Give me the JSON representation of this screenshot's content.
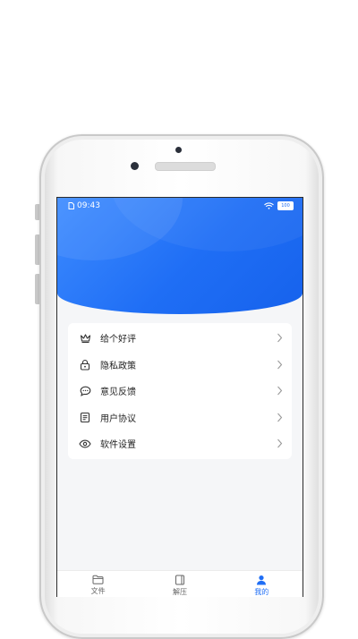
{
  "status_bar": {
    "time": "09:43",
    "battery": "100"
  },
  "menu": {
    "items": [
      {
        "label": "给个好评",
        "icon": "crown-icon"
      },
      {
        "label": "隐私政策",
        "icon": "lock-icon"
      },
      {
        "label": "意见反馈",
        "icon": "chat-icon"
      },
      {
        "label": "用户协议",
        "icon": "document-icon"
      },
      {
        "label": "软件设置",
        "icon": "eye-icon"
      }
    ]
  },
  "tabs": [
    {
      "label": "文件",
      "icon": "folder-icon",
      "active": false
    },
    {
      "label": "解压",
      "icon": "archive-icon",
      "active": false
    },
    {
      "label": "我的",
      "icon": "user-icon",
      "active": true
    }
  ],
  "colors": {
    "accent": "#1f6ef5",
    "background": "#f5f6f8"
  }
}
